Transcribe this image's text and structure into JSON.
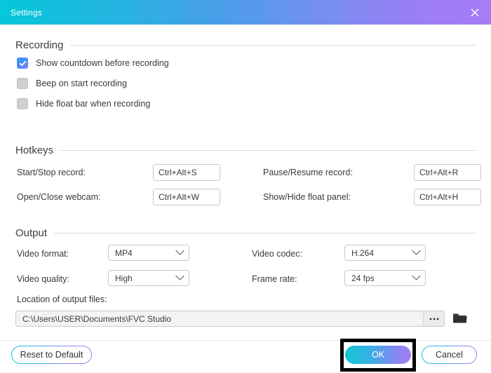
{
  "window": {
    "title": "Settings",
    "close_icon": "close-icon"
  },
  "sections": {
    "recording": {
      "title": "Recording",
      "checkboxes": [
        {
          "label": "Show countdown before recording",
          "checked": true
        },
        {
          "label": "Beep on start recording",
          "checked": false
        },
        {
          "label": "Hide float bar when recording",
          "checked": false
        }
      ]
    },
    "hotkeys": {
      "title": "Hotkeys",
      "items": [
        {
          "label": "Start/Stop record:",
          "value": "Ctrl+Alt+S"
        },
        {
          "label": "Pause/Resume record:",
          "value": "Ctrl+Alt+R"
        },
        {
          "label": "Open/Close webcam:",
          "value": "Ctrl+Alt+W"
        },
        {
          "label": "Show/Hide float panel:",
          "value": "Ctrl+Alt+H"
        }
      ]
    },
    "output": {
      "title": "Output",
      "dropdowns": [
        {
          "label": "Video format:",
          "value": "MP4"
        },
        {
          "label": "Video codec:",
          "value": "H.264"
        },
        {
          "label": "Video quality:",
          "value": "High"
        },
        {
          "label": "Frame rate:",
          "value": "24 fps"
        }
      ],
      "location_label": "Location of output files:",
      "location_value": "C:\\Users\\USER\\Documents\\FVC Studio",
      "browse_label": "...",
      "folder_icon": "folder-icon"
    }
  },
  "footer": {
    "reset_label": "Reset to Default",
    "ok_label": "OK",
    "cancel_label": "Cancel"
  },
  "colors": {
    "gradient_start": "#05c8d8",
    "gradient_end": "#a77df6",
    "highlight": "#000000",
    "border": "#c8c8c8"
  }
}
